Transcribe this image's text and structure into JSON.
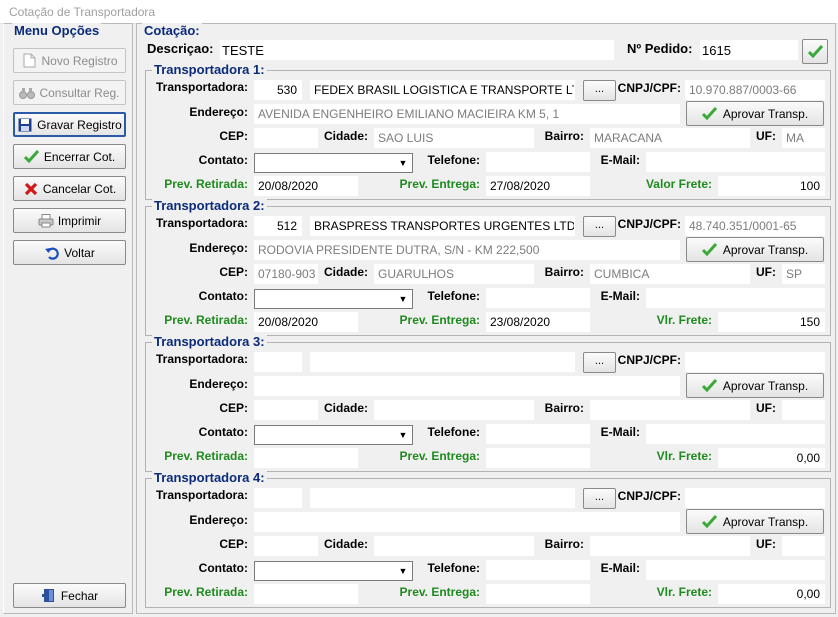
{
  "window": {
    "title": "Cotação de Transportadora"
  },
  "sidebar": {
    "title": "Menu Opções",
    "buttons": {
      "novo": "Novo Registro",
      "consultar": "Consultar Reg.",
      "gravar": "Gravar Registro",
      "encerrar": "Encerrar Cot.",
      "cancelar": "Cancelar Cot.",
      "imprimir": "Imprimir",
      "voltar": "Voltar",
      "fechar": "Fechar"
    }
  },
  "cotacao": {
    "title": "Cotação:",
    "descricao_label": "Descriçao:",
    "descricao_value": "TESTE",
    "pedido_label": "Nº Pedido:",
    "pedido_value": "1615"
  },
  "labels": {
    "transportadora": "Transportadora:",
    "cnpj": "CNPJ/CPF:",
    "endereco": "Endereço:",
    "cep": "CEP:",
    "cidade": "Cidade:",
    "bairro": "Bairro:",
    "uf": "UF:",
    "contato": "Contato:",
    "telefone": "Telefone:",
    "email": "E-Mail:",
    "prev_retirada": "Prev. Retirada:",
    "prev_entrega": "Prev. Entrega:",
    "aprovar": "Aprovar Transp.",
    "browse": "..."
  },
  "carriers": [
    {
      "title": "Transportadora 1:",
      "code": "530",
      "name": "FEDEX BRASIL LOGISTICA E TRANSPORTE LTDA",
      "cnpj": "10.970.887/0003-66",
      "endereco": "AVENIDA ENGENHEIRO EMILIANO MACIEIRA KM 5, 1",
      "cep": "",
      "cidade": "SAO LUIS",
      "bairro": "MARACANA",
      "uf": "MA",
      "contato": "",
      "telefone": "",
      "email": "",
      "prev_retirada": "20/08/2020",
      "prev_entrega": "27/08/2020",
      "frete_label": "Valor Frete:",
      "frete": "100"
    },
    {
      "title": "Transportadora 2:",
      "code": "512",
      "name": "BRASPRESS TRANSPORTES URGENTES LTDA",
      "cnpj": "48.740.351/0001-65",
      "endereco": "RODOVIA PRESIDENTE DUTRA, S/N - KM 222,500",
      "cep": "07180-903",
      "cidade": "GUARULHOS",
      "bairro": "CUMBICA",
      "uf": "SP",
      "contato": "",
      "telefone": "",
      "email": "",
      "prev_retirada": "20/08/2020",
      "prev_entrega": "23/08/2020",
      "frete_label": "Vlr. Frete:",
      "frete": "150"
    },
    {
      "title": "Transportadora 3:",
      "code": "",
      "name": "",
      "cnpj": "",
      "endereco": "",
      "cep": "",
      "cidade": "",
      "bairro": "",
      "uf": "",
      "contato": "",
      "telefone": "",
      "email": "",
      "prev_retirada": "",
      "prev_entrega": "",
      "frete_label": "Vlr. Frete:",
      "frete": "0,00"
    },
    {
      "title": "Transportadora 4:",
      "code": "",
      "name": "",
      "cnpj": "",
      "endereco": "",
      "cep": "",
      "cidade": "",
      "bairro": "",
      "uf": "",
      "contato": "",
      "telefone": "",
      "email": "",
      "prev_retirada": "",
      "prev_entrega": "",
      "frete_label": "Vlr. Frete:",
      "frete": "0,00"
    }
  ]
}
